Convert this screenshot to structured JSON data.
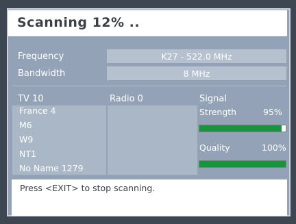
{
  "header": {
    "title": "Scanning  12% .."
  },
  "info": {
    "frequency_label": "Frequency",
    "frequency_value": "K27 - 522.0 MHz",
    "bandwidth_label": "Bandwidth",
    "bandwidth_value": "8 MHz"
  },
  "tv": {
    "header": "TV  10",
    "channels": [
      "France 4",
      "M6",
      "W9",
      "NT1",
      "No Name 1279"
    ]
  },
  "radio": {
    "header": "Radio  0"
  },
  "signal": {
    "header": "Signal",
    "strength_label": "Strength",
    "strength_value": "95%",
    "strength_fraction": 0.95,
    "quality_label": "Quality",
    "quality_value": "100%",
    "quality_fraction": 1.0
  },
  "footer": {
    "message": "Press <EXIT> to stop scanning."
  },
  "colors": {
    "bar_fill": "#1a9240",
    "panel": "#93a2b6"
  }
}
